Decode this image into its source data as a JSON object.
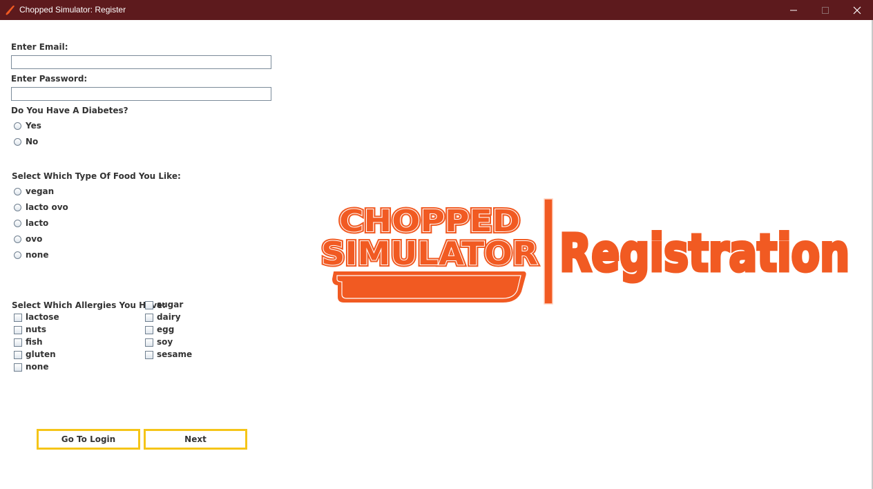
{
  "window": {
    "title": "Chopped Simulator: Register",
    "app_icon": "knife-icon",
    "controls": [
      "minimize-icon",
      "maximize-icon",
      "close-icon"
    ]
  },
  "form": {
    "email_label": "Enter Email:",
    "email_value": "",
    "password_label": "Enter Password:",
    "password_value": "",
    "diabetes_label": "Do You Have A Diabetes?",
    "diabetes_options": [
      "Yes",
      "No"
    ],
    "food_label": "Select Which Type Of Food You Like:",
    "food_options": [
      "vegan",
      "lacto ovo",
      "lacto",
      "ovo",
      "none"
    ],
    "allergies_label": "Select Which Allergies You Have:",
    "allergies_left": [
      "lactose",
      "nuts",
      "fish",
      "gluten",
      "none"
    ],
    "allergies_right": [
      "sugar",
      "dairy",
      "egg",
      "soy",
      "sesame"
    ]
  },
  "buttons": {
    "login_label": "Go To Login",
    "next_label": "Next"
  },
  "logo": {
    "line1": "CHOPPED",
    "line2": "SIMULATOR",
    "title": "Registration",
    "color": "#f15a22"
  }
}
